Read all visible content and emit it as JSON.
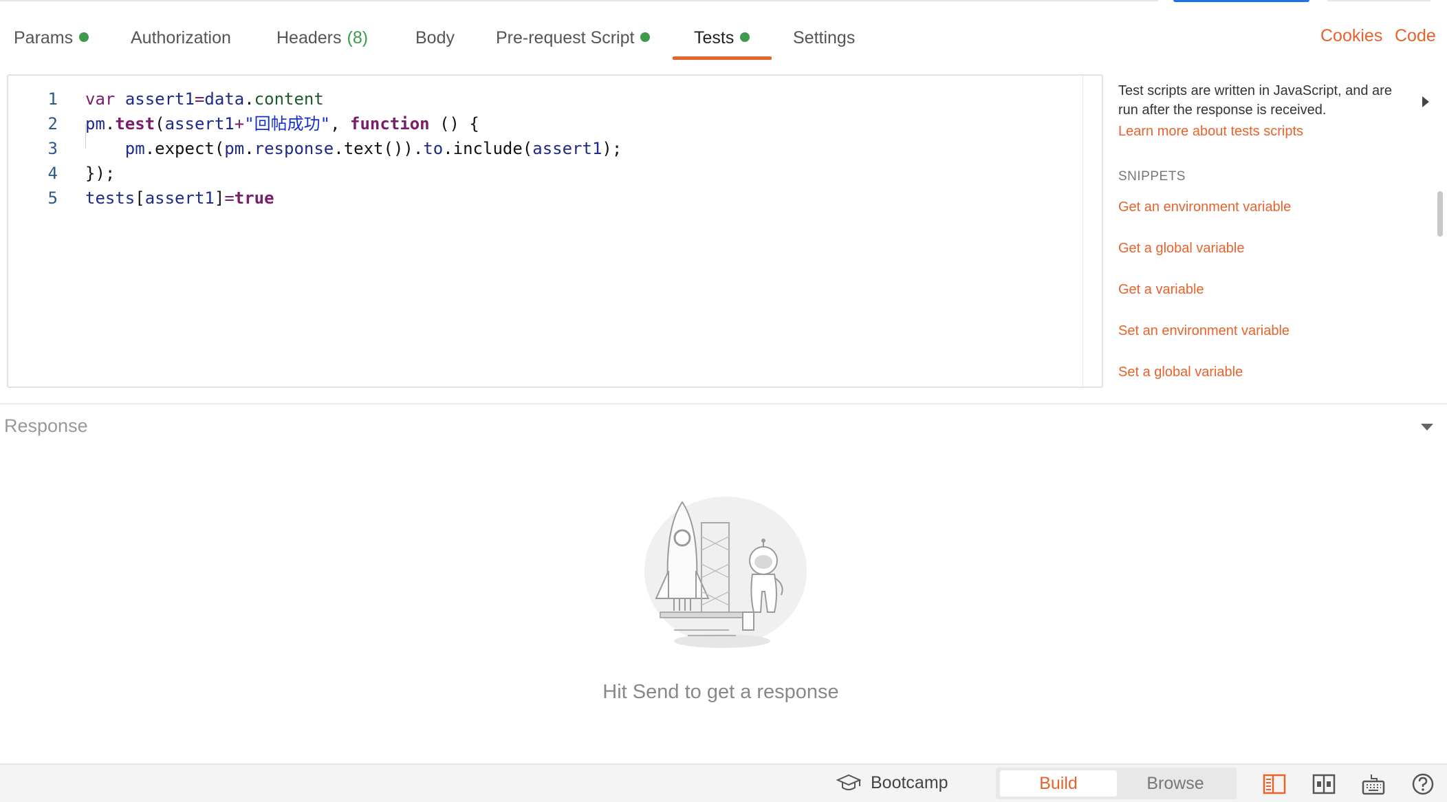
{
  "tabs": [
    {
      "label": "Params",
      "dot": true
    },
    {
      "label": "Authorization"
    },
    {
      "label": "Headers",
      "count": "(8)"
    },
    {
      "label": "Body"
    },
    {
      "label": "Pre-request Script",
      "dot": true
    },
    {
      "label": "Tests",
      "dot": true,
      "active": true
    },
    {
      "label": "Settings"
    }
  ],
  "top_links": {
    "cookies": "Cookies",
    "code": "Code"
  },
  "editor": {
    "line_numbers": [
      "1",
      "2",
      "3",
      "4",
      "5"
    ],
    "lines": [
      [
        {
          "t": "var",
          "c": "kw"
        },
        {
          "t": " "
        },
        {
          "t": "assert1",
          "c": "var"
        },
        {
          "t": "=",
          "c": "op"
        },
        {
          "t": "data",
          "c": "var"
        },
        {
          "t": ".",
          "c": "def"
        },
        {
          "t": "content",
          "c": "prop"
        }
      ],
      [
        {
          "t": "pm",
          "c": "var"
        },
        {
          "t": ".",
          "c": "def"
        },
        {
          "t": "test",
          "c": "kwb"
        },
        {
          "t": "(",
          "c": "def"
        },
        {
          "t": "assert1",
          "c": "var"
        },
        {
          "t": "+",
          "c": "op"
        },
        {
          "t": "\"回帖成功\"",
          "c": "str"
        },
        {
          "t": ", ",
          "c": "def"
        },
        {
          "t": "function",
          "c": "kwb"
        },
        {
          "t": " () {",
          "c": "def"
        }
      ],
      [
        {
          "t": "    "
        },
        {
          "t": "pm",
          "c": "var"
        },
        {
          "t": ".expect(",
          "c": "def"
        },
        {
          "t": "pm",
          "c": "var"
        },
        {
          "t": ".",
          "c": "def"
        },
        {
          "t": "response",
          "c": "var"
        },
        {
          "t": ".text()).",
          "c": "def"
        },
        {
          "t": "to",
          "c": "var"
        },
        {
          "t": ".include(",
          "c": "def"
        },
        {
          "t": "assert1",
          "c": "var"
        },
        {
          "t": ");",
          "c": "def"
        }
      ],
      [
        {
          "t": "});",
          "c": "def"
        }
      ],
      [
        {
          "t": "tests",
          "c": "var"
        },
        {
          "t": "[",
          "c": "def"
        },
        {
          "t": "assert1",
          "c": "var"
        },
        {
          "t": "]",
          "c": "def"
        },
        {
          "t": "=",
          "c": "op"
        },
        {
          "t": "true",
          "c": "kwb"
        }
      ]
    ]
  },
  "side_panel": {
    "description": "Test scripts are written in JavaScript, and are run after the response is received.",
    "learn_more": "Learn more about tests scripts",
    "snippets_title": "SNIPPETS",
    "snippets": [
      "Get an environment variable",
      "Get a global variable",
      "Get a variable",
      "Set an environment variable",
      "Set a global variable"
    ]
  },
  "response": {
    "title": "Response",
    "empty_message": "Hit Send to get a response"
  },
  "bottom_bar": {
    "bootcamp": "Bootcamp",
    "build": "Build",
    "browse": "Browse",
    "icons": [
      "two-pane-view-icon",
      "layout-icon",
      "keyboard-shortcuts-icon",
      "help-icon"
    ]
  },
  "colors": {
    "accent": "#e8622b",
    "status_green": "#3e9a4d",
    "send_blue": "#1a73e8"
  }
}
